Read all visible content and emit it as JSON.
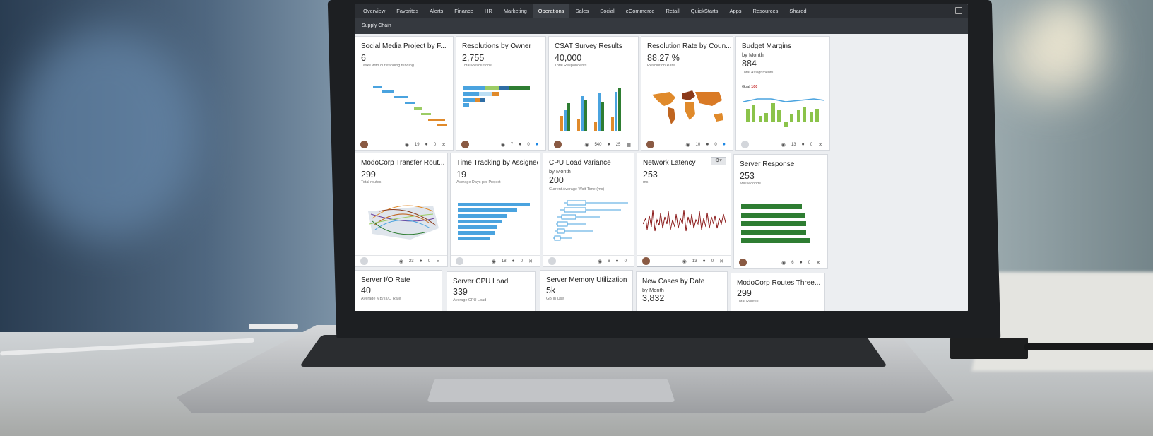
{
  "nav": {
    "items": [
      "Overview",
      "Favorites",
      "Alerts",
      "Finance",
      "HR",
      "Marketing",
      "Operations",
      "Sales",
      "Social",
      "eCommerce",
      "Retail",
      "QuickStarts",
      "Apps",
      "Resources",
      "Shared"
    ],
    "active": "Operations"
  },
  "subnav": {
    "label": "Supply Chain"
  },
  "cards": [
    {
      "title": "Social Media Project by F...",
      "value": "6",
      "desc": "Tasks with outstanding funding",
      "views": "19",
      "comments": "0"
    },
    {
      "title": "Resolutions by Owner",
      "value": "2,755",
      "desc": "Total Resolutions",
      "views": "7",
      "comments": "0"
    },
    {
      "title": "CSAT Survey Results",
      "value": "40,000",
      "desc": "Total Respondents",
      "views": "540",
      "comments": "25"
    },
    {
      "title": "Resolution Rate by Coun...",
      "value": "88.27 %",
      "desc": "Resolution Rate",
      "views": "10",
      "comments": "0"
    },
    {
      "title": "Budget Margins",
      "sub": "by Month",
      "value": "884",
      "desc": "Total Assignments",
      "goal_label": "Goal",
      "goal_value": "100",
      "views": "13",
      "comments": "0"
    },
    {
      "title": "ModoCorp Transfer Rout...",
      "value": "299",
      "desc": "Total routes",
      "views": "23",
      "comments": "0"
    },
    {
      "title": "Time Tracking by Assignee",
      "value": "19",
      "desc": "Average Days per Project",
      "views": "18",
      "comments": "0"
    },
    {
      "title": "CPU Load Variance",
      "sub": "by Month",
      "value": "200",
      "desc": "Current Average Wait Time (ms)",
      "views": "6",
      "comments": "0"
    },
    {
      "title": "Network Latency",
      "value": "253",
      "desc": "ms",
      "views": "13",
      "comments": "0"
    },
    {
      "title": "Server Response",
      "value": "253",
      "desc": "Milliseconds",
      "views": "6",
      "comments": "0"
    },
    {
      "title": "Server I/O Rate",
      "value": "40",
      "desc": "Average MB/s I/O Rate"
    },
    {
      "title": "Server CPU Load",
      "value": "339",
      "desc": "Average CPU Load"
    },
    {
      "title": "Server Memory Utilization",
      "value": "5k",
      "desc": "GB In Use"
    },
    {
      "title": "New Cases by Date",
      "sub": "by Month",
      "value": "3,832"
    },
    {
      "title": "ModoCorp Routes Three...",
      "value": "299",
      "desc": "Total Routes"
    }
  ],
  "colors": {
    "accent_blue": "#4aa3df",
    "orange": "#e08a2b",
    "green": "#2e7d32",
    "lime": "#8bc34a",
    "map_brown": "#8b3a1a"
  },
  "icons": [
    "eye-icon",
    "comment-icon",
    "share-icon",
    "pin-icon",
    "calendar-icon",
    "wrench-icon",
    "expand-icon"
  ]
}
